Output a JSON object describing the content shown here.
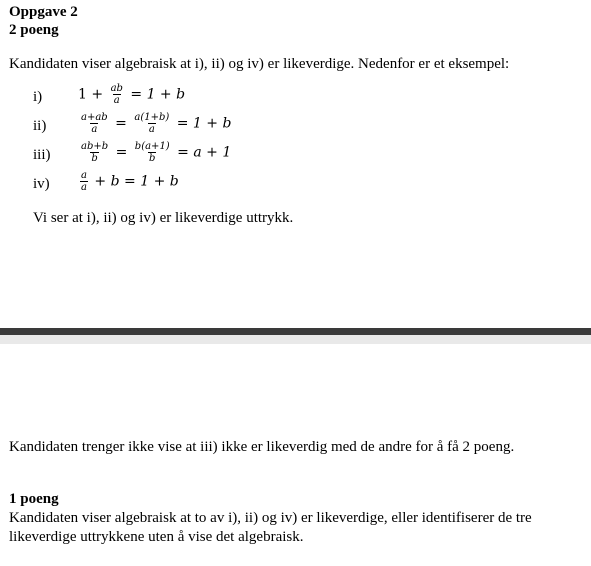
{
  "task": {
    "title": "Oppgave 2",
    "points": "2 poeng",
    "intro": "Kandidaten viser algebraisk at i), ii) og iv) er likeverdige. Nedenfor er et eksempel:"
  },
  "example": {
    "labels": [
      "i)",
      "ii)",
      "iii)",
      "iv)"
    ],
    "row1": {
      "one": "1",
      "plus": "+",
      "num": "ab",
      "den": "a",
      "eq": "=",
      "rhs": "1 + b"
    },
    "row2": {
      "num1": "a+ab",
      "den1": "a",
      "eq1": "=",
      "num2": "a(1+b)",
      "den2": "a",
      "eq2": "=",
      "rhs": "1 + b"
    },
    "row3": {
      "num1": "ab+b",
      "den1": "b",
      "eq1": "=",
      "num2": "b(a+1)",
      "den2": "b",
      "eq2": "=",
      "rhs": "a + 1"
    },
    "row4": {
      "num": "a",
      "den": "a",
      "mid": "+ b",
      "eq": "=",
      "rhs": "1 + b"
    },
    "conclusion": "Vi ser at i), ii) og iv) er likeverdige uttrykk."
  },
  "note": "Kandidaten trenger ikke vise at iii) ikke er likeverdig med de andre for å få 2 poeng.",
  "one_point": {
    "title": "1 poeng",
    "text": "Kandidaten viser algebraisk at to av i), ii) og iv) er likeverdige, eller identifiserer de tre likeverdige uttrykkene uten å vise det algebraisk."
  }
}
